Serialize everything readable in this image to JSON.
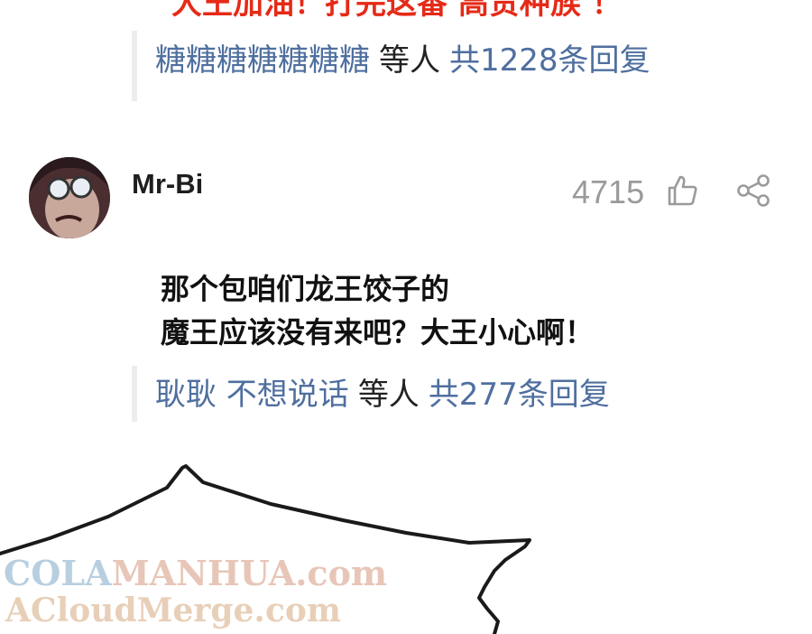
{
  "top_comment": {
    "text": "大王加油！打完这番 高贵种族 ！"
  },
  "reply_summary_1": {
    "names": "糖糖糖糖糖糖糖",
    "and_others": "等人",
    "count": "共1228条回复"
  },
  "comment": {
    "username": "Mr-Bi",
    "likes": "4715",
    "line1": "那个包咱们龙王饺子的",
    "line2": "魔王应该没有来吧？大王小心啊！",
    "icons": {
      "like": "thumbs-up-icon",
      "share": "share-icon"
    }
  },
  "reply_summary_2": {
    "names": "耿耿 不想说话",
    "and_others": "等人",
    "count": "共277条回复"
  },
  "watermark": {
    "cola": "COLA",
    "manhua": "MANHUA.com",
    "acloud": "ACloudMerge.com"
  }
}
